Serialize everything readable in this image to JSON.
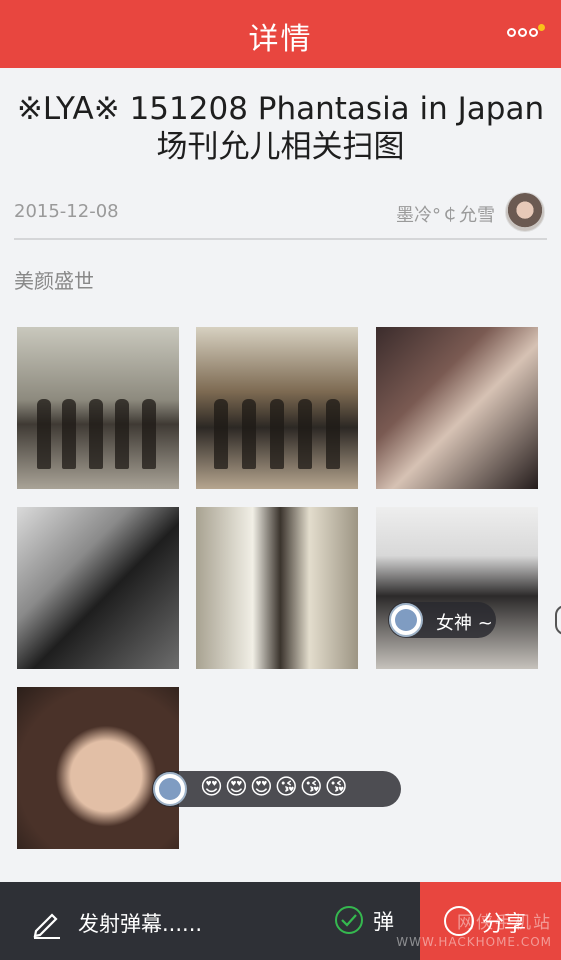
{
  "header": {
    "title": "详情",
    "more_icon": "more-dots-icon"
  },
  "post": {
    "title": "※LYA※ 151208 Phantasia in Japan场刊允儿相关扫图",
    "date": "2015-12-08",
    "author": "墨冷°￠允雪",
    "subtitle": "美颜盛世"
  },
  "danmaku": {
    "comment_1": "女神 ~",
    "comment_2": "😍😍😍😘😘😘"
  },
  "bottom_bar": {
    "send_placeholder": "发射弹幕......",
    "toggle_label": "弹",
    "share_label": "分享",
    "accent": "#e8463f",
    "check_color": "#35b84f"
  },
  "watermark": {
    "line1": "网侠手机站",
    "line2": "WWW.HACKHOME.COM"
  }
}
